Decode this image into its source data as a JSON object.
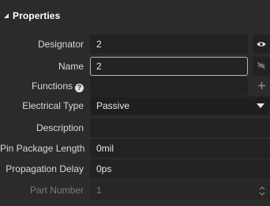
{
  "header": {
    "title": "Properties",
    "collapse_icon": "triangle-down-icon"
  },
  "fields": {
    "designator": {
      "label": "Designator",
      "value": "2"
    },
    "name": {
      "label": "Name",
      "value": "2"
    },
    "functions": {
      "label": "Functions",
      "value": ""
    },
    "electrical_type": {
      "label": "Electrical Type",
      "value": "Passive"
    },
    "description": {
      "label": "Description",
      "value": ""
    },
    "pin_package_length": {
      "label": "Pin Package Length",
      "value": "0mil"
    },
    "propagation_delay": {
      "label": "Propagation Delay",
      "value": "0ps"
    },
    "part_number": {
      "label": "Part Number",
      "value": "1"
    }
  },
  "icons": {
    "visibility": "eye-icon",
    "hidden": "eye-slash-icon",
    "add": "plus-icon",
    "help": "help-icon",
    "dropdown": "caret-down-icon",
    "stepper": "spin-stepper-icon"
  },
  "colors": {
    "background": "#2b2b2b",
    "field": "#222222",
    "focus_border": "#b3b3b3",
    "disabled_text": "#7b7b7b"
  }
}
